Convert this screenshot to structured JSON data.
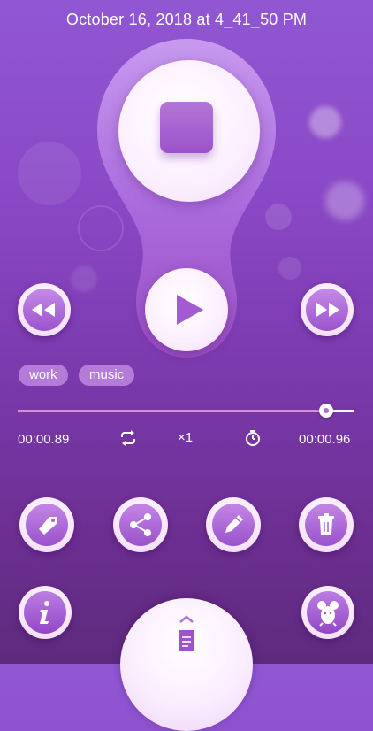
{
  "header": {
    "title": "October 16, 2018 at 4_41_50 PM"
  },
  "tags": [
    "work",
    "music"
  ],
  "playback": {
    "elapsed": "00:00.89",
    "total": "00:00.96",
    "speed": "×1",
    "progress": 0.917
  },
  "icons": {
    "stop": "stop-icon",
    "play": "play-icon",
    "rewind": "rewind-icon",
    "fast_forward": "fast-forward-icon",
    "repeat": "repeat-icon",
    "timer": "timer-icon",
    "tag": "tag-icon",
    "share": "share-icon",
    "edit": "pencil-icon",
    "delete": "trash-icon",
    "info": "info-icon",
    "mouse": "mouse-icon",
    "notes": "document-icon",
    "drawer_chevron": "chevron-up-icon"
  },
  "colors": {
    "accent": "#a25bd0",
    "background_top": "#9157d2",
    "background_bottom": "#5e2a7d",
    "progress_fill": "#d78ed6",
    "tag_bg": "#b57bd9"
  }
}
